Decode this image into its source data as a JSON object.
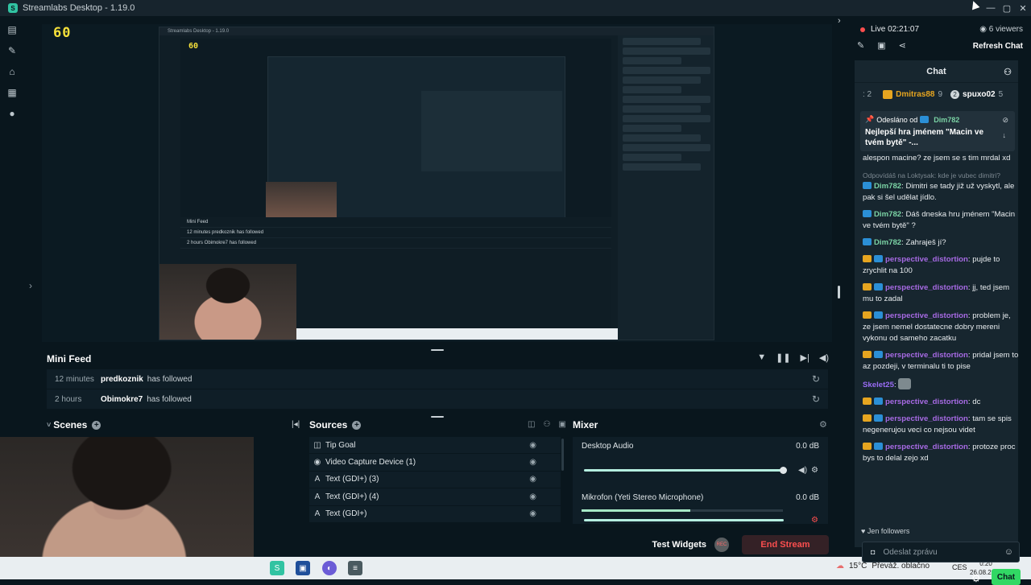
{
  "window": {
    "title": "Streamlabs Desktop - 1.19.0",
    "controls": [
      "—",
      "▢",
      "✕"
    ]
  },
  "preview": {
    "fps": "60",
    "nested_fps": "60",
    "nested_title": "Streamlabs Desktop - 1.19.0",
    "nested_minifeed": [
      "Mini Feed",
      "12 minutes  predkoznik  has followed",
      "2 hours  Obimokre7  has followed"
    ]
  },
  "minifeed": {
    "title": "Mini Feed",
    "rows": [
      {
        "time": "12 minutes",
        "name": "predkoznik",
        "action": "has followed"
      },
      {
        "time": "2 hours",
        "name": "Obimokre7",
        "action": "has followed"
      }
    ]
  },
  "scenes": {
    "title": "Scenes"
  },
  "sources": {
    "title": "Sources",
    "items": [
      {
        "icon": "◫",
        "label": "Tip Goal"
      },
      {
        "icon": "◉",
        "label": "Video Capture Device (1)"
      },
      {
        "icon": "A",
        "label": "Text (GDI+) (3)"
      },
      {
        "icon": "A",
        "label": "Text (GDI+) (4)"
      },
      {
        "icon": "A",
        "label": "Text (GDI+)"
      }
    ]
  },
  "mixer": {
    "title": "Mixer",
    "channels": [
      {
        "label": "Desktop Audio",
        "db": "0.0 dB",
        "level": 1.0
      },
      {
        "label": "Mikrofon (Yeti Stereo Microphone)",
        "db": "0.0 dB",
        "level": 0.54
      }
    ]
  },
  "footer": {
    "test_widgets": "Test Widgets",
    "end_stream": "End Stream"
  },
  "taskbar": {
    "temp": "15°C",
    "weather": "Převáž. oblačno",
    "lang": "CES",
    "time": "0:20",
    "date": "26.08.2026"
  },
  "chat": {
    "live": "Live 02:21:07",
    "viewers": "6 viewers",
    "refresh": "Refresh Chat",
    "title": "Chat",
    "top_rank": ": 2",
    "top_user_1": "Dmitras88",
    "top_user_1_count": "9",
    "top_user_2": "spuxo02",
    "top_user_2_count": "5",
    "pinned_from": "Odesláno od",
    "pinned_user": "Dim782",
    "pinned_text": "Nejlepší hra jménem \"Macin ve tvém bytě\" -...",
    "messages": [
      {
        "user": "",
        "text": "alespon macine? ze jsem se s tim mrdal xd",
        "class": ""
      },
      {
        "reply": "Odpovídáš na Loktysak: kde je vubec dimitri?",
        "user": "Dim782",
        "text": ": Dimitri se tady již už vyskytl, ale pak si šel udělat jídlo.",
        "class": "name-green"
      },
      {
        "user": "Dim782",
        "text": ": Dáš dneska hru jménem \"Macin ve tvém bytě\" ?",
        "class": "name-green"
      },
      {
        "user": "Dim782",
        "text": ": Zahraješ jí?",
        "class": "name-green"
      },
      {
        "user": "perspective_distortion",
        "text": ": pujde to zrychlit na 100",
        "class": "name-purple"
      },
      {
        "user": "perspective_distortion",
        "text": ": jj, ted jsem mu to zadal",
        "class": "name-purple"
      },
      {
        "user": "perspective_distortion",
        "text": ": problem je, ze jsem nemel dostatecne dobry mereni vykonu od sameho zacatku",
        "class": "name-purple"
      },
      {
        "user": "perspective_distortion",
        "text": ": pridal jsem to az pozdeji, v terminalu ti to pise",
        "class": "name-purple"
      },
      {
        "user": "Skelet25",
        "text": ":",
        "class": "name-violet"
      },
      {
        "user": "perspective_distortion",
        "text": ": dc",
        "class": "name-purple"
      },
      {
        "user": "perspective_distortion",
        "text": ": tam se spis negenerujou veci co nejsou videt",
        "class": "name-purple"
      },
      {
        "user": "perspective_distortion",
        "text": ": protoze proc bys to delal zejo xd",
        "class": "name-purple"
      }
    ],
    "followers": "Jen followers",
    "input_placeholder": "Odeslat zprávu",
    "send": "Chat"
  }
}
